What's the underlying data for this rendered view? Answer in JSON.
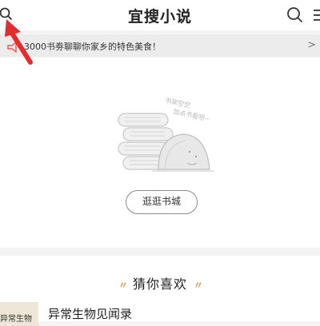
{
  "header": {
    "title": "宜搜小说",
    "search_icon": "search-icon",
    "menu_icon": "menu-icon"
  },
  "notice": {
    "text": "3000书劵聊聊你家乡的特色美食！",
    "arrow": ">",
    "icon": "megaphone-icon"
  },
  "empty_state": {
    "illustration_text_line1": "书架空空",
    "illustration_text_line2": "加点书看吧",
    "button_label": "逛逛书城"
  },
  "recommendations": {
    "title": "猜你喜欢",
    "deco_left": "〃",
    "deco_right": "〃",
    "items": [
      {
        "cover_text": "异常生物",
        "title": "异常生物见闻录"
      }
    ]
  },
  "annotation": {
    "color": "#e52b2b"
  }
}
